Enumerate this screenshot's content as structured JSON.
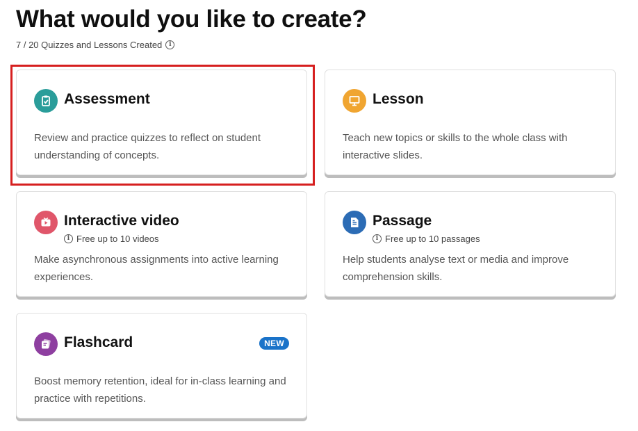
{
  "header": {
    "title": "What would you like to create?",
    "usage_text": "7 / 20 Quizzes and Lessons Created"
  },
  "cards": [
    {
      "title": "Assessment",
      "subtitle": "",
      "description": "Review and practice quizzes to reflect on student understanding of concepts.",
      "icon": "clipboard-check-icon",
      "color": "#2a9d9a",
      "selected": true
    },
    {
      "title": "Lesson",
      "subtitle": "",
      "description": "Teach new topics or skills to the whole class with interactive slides.",
      "icon": "presentation-board-icon",
      "color": "#f0a531"
    },
    {
      "title": "Interactive video",
      "subtitle": "Free up to 10 videos",
      "description": "Make asynchronous assignments into active learning experiences.",
      "icon": "video-play-icon",
      "color": "#e0566a"
    },
    {
      "title": "Passage",
      "subtitle": "Free up to 10 passages",
      "description": "Help students analyse text or media and improve comprehension skills.",
      "icon": "document-icon",
      "color": "#2c6cb5"
    },
    {
      "title": "Flashcard",
      "subtitle": "",
      "badge": "NEW",
      "description": "Boost memory retention, ideal for in-class learning and practice with repetitions.",
      "icon": "flashcard-icon",
      "color": "#8e3fa0"
    }
  ]
}
